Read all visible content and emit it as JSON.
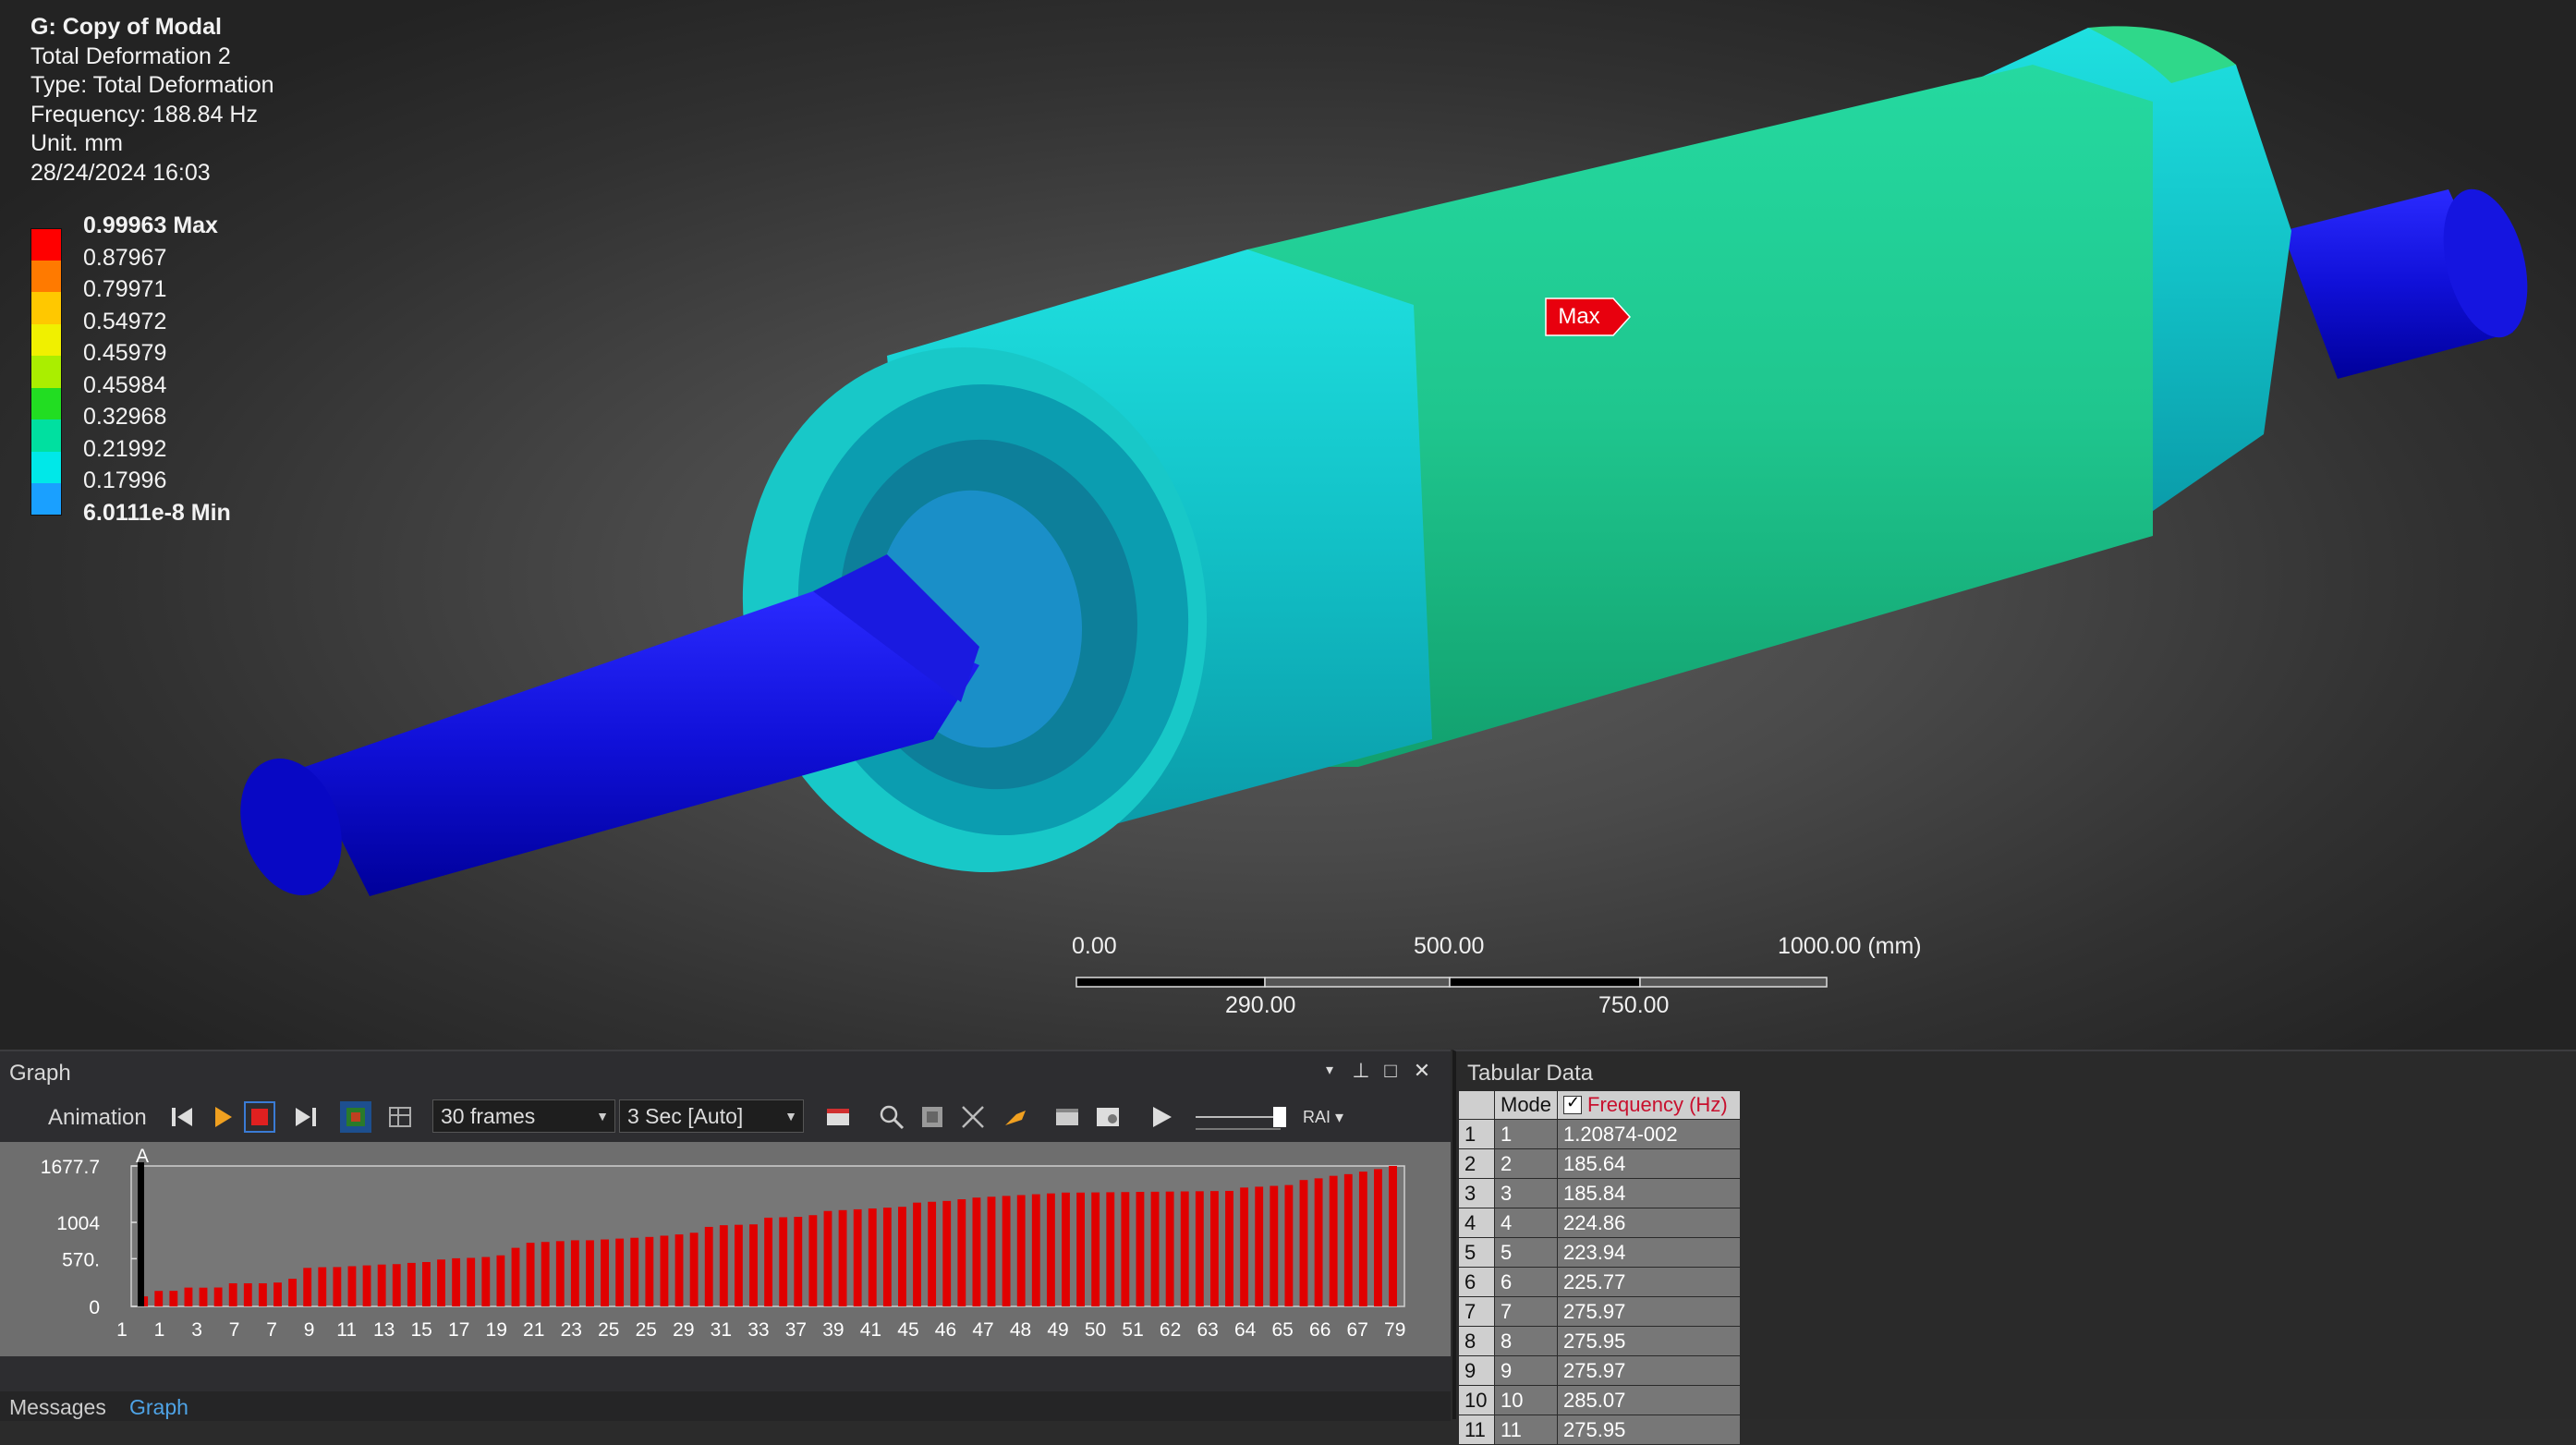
{
  "info": {
    "title": "G: Copy of Modal",
    "result": "Total Deformation 2",
    "type": "Type: Total Deformation",
    "frequency": "Frequency: 188.84 Hz",
    "unit": "Unit. mm",
    "datetime": "28/24/2024 16:03"
  },
  "legend": {
    "labels": [
      "0.99963 Max",
      "0.87967",
      "0.79971",
      "0.54972",
      "0.45979",
      "0.45984",
      "0.32968",
      "0.21992",
      "0.17996",
      "6.0111e-8 Min"
    ],
    "colors": [
      "#ff0000",
      "#ff7a00",
      "#ffc800",
      "#f0f000",
      "#aaee00",
      "#22dd22",
      "#00e0a0",
      "#00e8e8",
      "#1aa0ff",
      "#0000e6"
    ]
  },
  "max_tag": "Max",
  "scale_bar": {
    "top_labels": [
      "0.00",
      "500.00",
      "1000.00 (mm)"
    ],
    "bottom_labels": [
      "290.00",
      "750.00"
    ]
  },
  "graph_panel": {
    "title": "Graph",
    "animation_label": "Animation",
    "frames_value": "30 frames",
    "duration_value": "3 Sec [Auto]",
    "icons": [
      "skip-start-icon",
      "play-icon",
      "stop-icon",
      "skip-end-icon",
      "distributed-icon",
      "result-sets-icon",
      "export-icon",
      "zoom-icon",
      "zoom-fit-icon",
      "cursor-icon",
      "probe-icon",
      "window-icon",
      "image-icon",
      "run-icon",
      "slider",
      "rai-icon"
    ],
    "bottom_tabs": [
      "Messages",
      "Graph"
    ],
    "marker_label": "A"
  },
  "chart_data": {
    "type": "bar",
    "title": "",
    "xlabel": "",
    "ylabel": "",
    "ylim": [
      0,
      1677.7
    ],
    "y_tick_labels": [
      "0",
      "570.",
      "1004",
      "1677.7"
    ],
    "x_tick_labels": [
      "1",
      "1",
      "3",
      "7",
      "7",
      "9",
      "11",
      "13",
      "15",
      "17",
      "19",
      "21",
      "23",
      "25",
      "25",
      "29",
      "31",
      "33",
      "37",
      "39",
      "41",
      "45",
      "46",
      "47",
      "48",
      "49",
      "50",
      "51",
      "62",
      "63",
      "64",
      "65",
      "66",
      "67",
      "79"
    ],
    "bar_color": "#e00000",
    "values": [
      120,
      185,
      186,
      225,
      224,
      226,
      276,
      276,
      276,
      285,
      330,
      460,
      468,
      470,
      480,
      490,
      500,
      505,
      520,
      530,
      560,
      575,
      580,
      590,
      610,
      700,
      760,
      770,
      780,
      790,
      790,
      800,
      810,
      820,
      830,
      845,
      860,
      880,
      950,
      970,
      975,
      980,
      1060,
      1065,
      1070,
      1090,
      1140,
      1150,
      1160,
      1170,
      1180,
      1190,
      1240,
      1250,
      1260,
      1280,
      1300,
      1310,
      1320,
      1330,
      1340,
      1350,
      1360,
      1360,
      1362,
      1364,
      1366,
      1368,
      1370,
      1372,
      1374,
      1376,
      1378,
      1380,
      1420,
      1430,
      1440,
      1450,
      1510,
      1530,
      1560,
      1580,
      1610,
      1640,
      1677.7
    ],
    "marker": {
      "label": "A",
      "value": 1677.7
    }
  },
  "tabular": {
    "title": "Tabular Data",
    "columns": [
      "Mode",
      "Frequency (Hz)"
    ],
    "rows": [
      {
        "n": "1",
        "mode": "1",
        "freq": "1.20874-002"
      },
      {
        "n": "2",
        "mode": "2",
        "freq": "185.64"
      },
      {
        "n": "3",
        "mode": "3",
        "freq": "185.84"
      },
      {
        "n": "4",
        "mode": "4",
        "freq": "224.86"
      },
      {
        "n": "5",
        "mode": "5",
        "freq": "223.94"
      },
      {
        "n": "6",
        "mode": "6",
        "freq": "225.77"
      },
      {
        "n": "7",
        "mode": "7",
        "freq": "275.97"
      },
      {
        "n": "8",
        "mode": "8",
        "freq": "275.95"
      },
      {
        "n": "9",
        "mode": "9",
        "freq": "275.97"
      },
      {
        "n": "10",
        "mode": "10",
        "freq": "285.07"
      },
      {
        "n": "11",
        "mode": "11",
        "freq": "275.95"
      }
    ]
  }
}
